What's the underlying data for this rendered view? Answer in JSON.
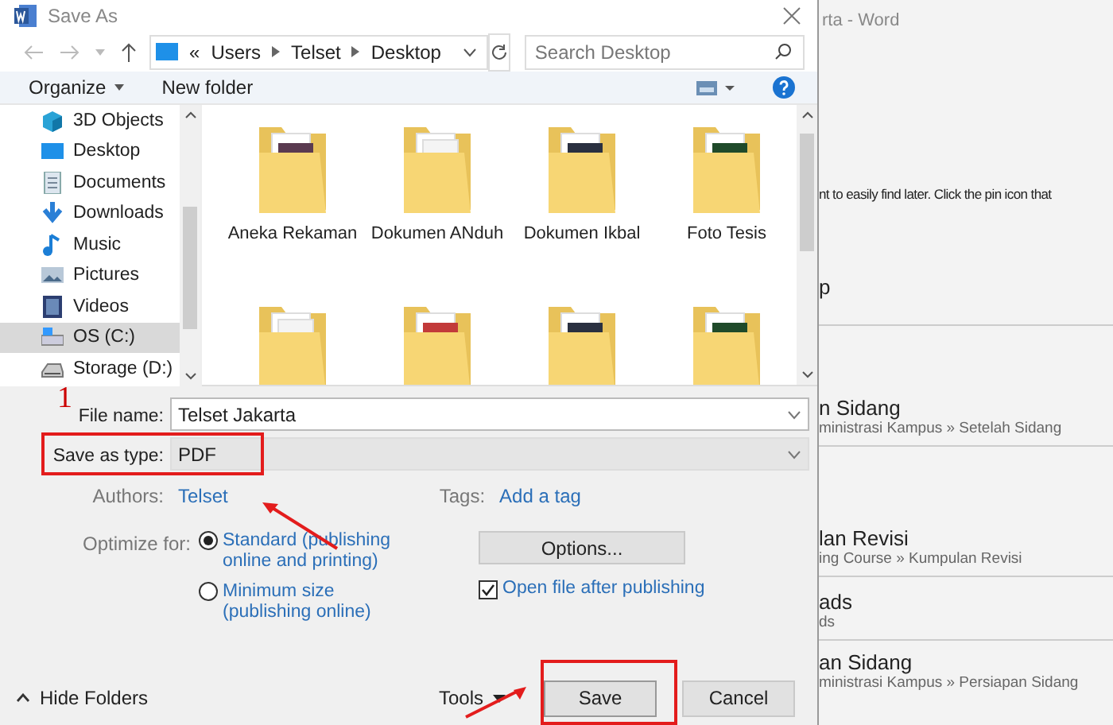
{
  "window": {
    "title": "Save As"
  },
  "address_bar": {
    "prefix": "«",
    "path": [
      "Users",
      "Telset",
      "Desktop"
    ]
  },
  "search": {
    "placeholder": "Search Desktop"
  },
  "toolbar": {
    "organize": "Organize",
    "new_folder": "New folder"
  },
  "sidebar": {
    "items": [
      {
        "label": "3D Objects",
        "kind": "cube",
        "selected": false
      },
      {
        "label": "Desktop",
        "kind": "desktop",
        "selected": false
      },
      {
        "label": "Documents",
        "kind": "document",
        "selected": false
      },
      {
        "label": "Downloads",
        "kind": "download",
        "selected": false
      },
      {
        "label": "Music",
        "kind": "music",
        "selected": false
      },
      {
        "label": "Pictures",
        "kind": "pictures",
        "selected": false
      },
      {
        "label": "Videos",
        "kind": "videos",
        "selected": false
      },
      {
        "label": "OS (C:)",
        "kind": "drive",
        "selected": true
      },
      {
        "label": "Storage (D:)",
        "kind": "disk",
        "selected": false
      }
    ]
  },
  "files": [
    {
      "name": "Aneka Rekaman",
      "kind": "preview"
    },
    {
      "name": "Dokumen ANduh",
      "kind": "plain"
    },
    {
      "name": "Dokumen Ikbal",
      "kind": "preview"
    },
    {
      "name": "Foto Tesis",
      "kind": "preview"
    },
    {
      "kind": "plain"
    },
    {
      "kind": "preview"
    },
    {
      "kind": "preview"
    },
    {
      "kind": "preview"
    }
  ],
  "form": {
    "file_name": {
      "label": "File name:",
      "value": "Telset Jakarta"
    },
    "save_type": {
      "label": "Save as type:",
      "value": "PDF"
    },
    "authors": {
      "label": "Authors:",
      "value": "Telset"
    },
    "tags": {
      "label": "Tags:",
      "value": "Add a tag"
    },
    "optimize": {
      "label": "Optimize for:",
      "options": [
        {
          "label": "Standard (publishing online and printing)",
          "selected": true
        },
        {
          "label": "Minimum size (publishing online)",
          "selected": false
        }
      ]
    },
    "options_button": "Options...",
    "open_after": {
      "label": "Open file after publishing",
      "checked": true
    }
  },
  "footer": {
    "hide_folders": "Hide Folders",
    "tools": "Tools",
    "buttons": [
      {
        "label": "Save",
        "kind": "default"
      },
      {
        "label": "Cancel",
        "kind": "normal"
      }
    ]
  },
  "annotation": {
    "step_number": "1"
  },
  "background": {
    "title": "rta - Word",
    "hint": "nt to easily find later. Click the pin icon that",
    "heading": "p",
    "items": [
      {
        "title": "n Sidang",
        "path": "ministrasi Kampus » Setelah Sidang"
      },
      {
        "title": "lan Revisi",
        "path": "ing Course » Kumpulan Revisi"
      },
      {
        "title": "ads",
        "path": "ds"
      },
      {
        "title": "an Sidang",
        "path": "ministrasi Kampus » Persiapan Sidang"
      }
    ]
  }
}
